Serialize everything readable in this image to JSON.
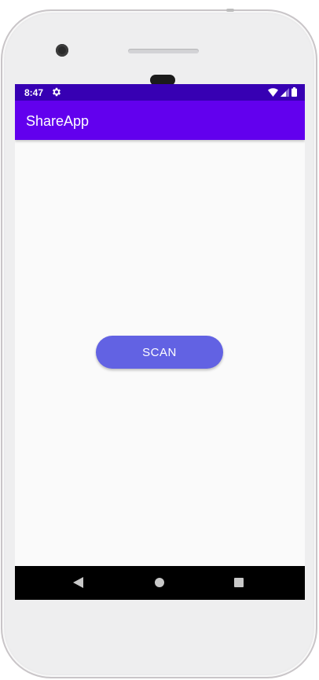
{
  "status_bar": {
    "time": "8:47",
    "icons": [
      "gear-icon",
      "wifi-icon",
      "signal-icon",
      "battery-icon"
    ]
  },
  "app_bar": {
    "title": "ShareApp"
  },
  "main": {
    "scan_button_label": "SCAN"
  },
  "nav_bar": {
    "icons": [
      "back-icon",
      "home-icon",
      "recents-icon"
    ]
  },
  "colors": {
    "status_bar": "#3700b3",
    "app_bar": "#6200ee",
    "button": "#6262e3",
    "background": "#fafafa",
    "nav_bar": "#000000"
  }
}
